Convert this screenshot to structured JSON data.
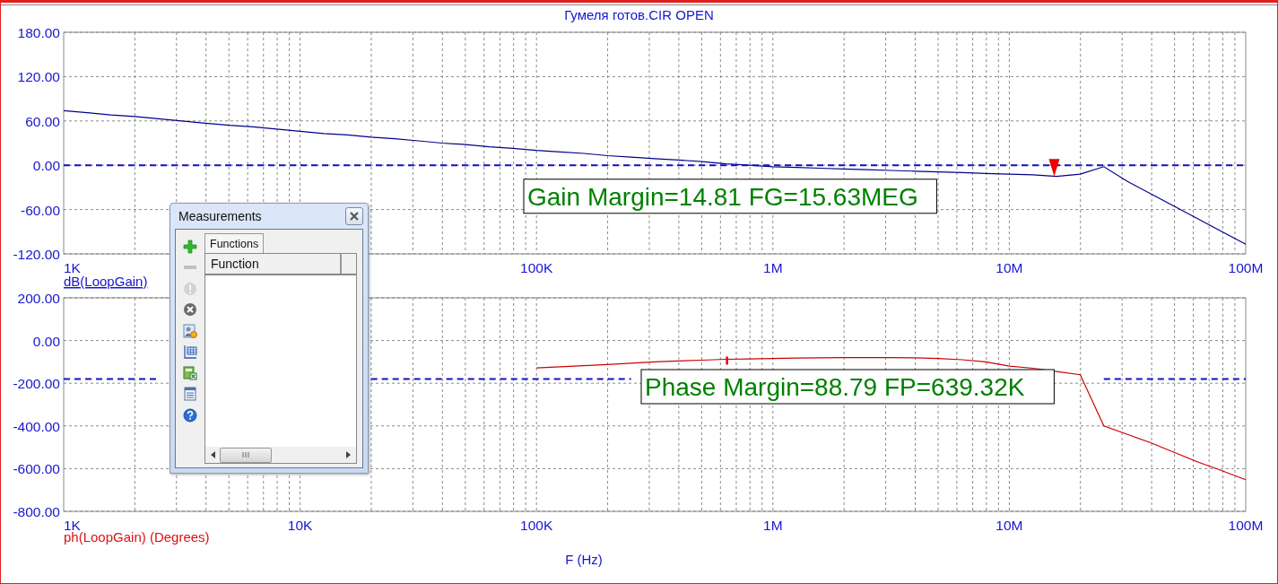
{
  "title": "Гумеля готов.CIR OPEN",
  "charts": [
    {
      "cursor": {
        "level": 0.838
      },
      "chart_data": {
        "type": "line",
        "grid": true,
        "categories": [
          "1K",
          null,
          null,
          null,
          null,
          null,
          null,
          null,
          null,
          null,
          null,
          null,
          null,
          null,
          null,
          null,
          null,
          null,
          null,
          null,
          "100K",
          null,
          null,
          null,
          null,
          null,
          null,
          null,
          null,
          null,
          "1M",
          null,
          null,
          null,
          null,
          null,
          null,
          null,
          null,
          null,
          "10M",
          null,
          null,
          null,
          null,
          null,
          null,
          null,
          null,
          null,
          "100M"
        ],
        "series": [
          {
            "name": "dB(LoopGain)",
            "color": "#00008b",
            "values": [
              74,
              71,
              68,
              66,
              63,
              60,
              57,
              54,
              52,
              49,
              46,
              43,
              41,
              38,
              36,
              33,
              30,
              28,
              25,
              23,
              20,
              18,
              16,
              13,
              11,
              9,
              7,
              5,
              2,
              0,
              -2,
              -3,
              -4,
              -5,
              -6,
              -7,
              -8,
              -9,
              -10,
              -11,
              -12,
              -13,
              -15,
              -12,
              -2,
              -22,
              -39,
              -56,
              -73,
              -90,
              -107
            ]
          },
          {
            "color": "#1010cc",
            "line_style": "dashed",
            "values": [
              0,
              0,
              0,
              0,
              0,
              0,
              0,
              0,
              0,
              0,
              0,
              0,
              0,
              0,
              0,
              0,
              0,
              0,
              0,
              0,
              0,
              0,
              0,
              0,
              0,
              0,
              0,
              0,
              0,
              0,
              0,
              0,
              0,
              0,
              0,
              0,
              0,
              0,
              0,
              0,
              0,
              0,
              0,
              0,
              0,
              0,
              0,
              0,
              0,
              0,
              0
            ]
          }
        ],
        "ylim": [
          -120,
          180
        ],
        "yticks": [
          {
            "value": 180,
            "label": "180.00"
          },
          {
            "value": 120,
            "label": "120.00"
          },
          {
            "value": 60,
            "label": "60.00"
          },
          {
            "value": 0,
            "label": "0.00"
          },
          {
            "value": -60,
            "label": "-60.00"
          },
          {
            "value": -120,
            "label": "-120.00"
          }
        ],
        "annotations": [
          "Gain Margin=14.81 FG=15.63MEG"
        ]
      }
    },
    {
      "cursor": {
        "level": 0.561
      },
      "chart_data": {
        "type": "line",
        "grid": true,
        "xlabel": "F (Hz)",
        "categories": [
          "1K",
          null,
          null,
          null,
          null,
          null,
          null,
          null,
          null,
          null,
          "10K",
          null,
          null,
          null,
          null,
          null,
          null,
          null,
          null,
          null,
          "100K",
          null,
          null,
          null,
          null,
          null,
          null,
          null,
          null,
          null,
          "1M",
          null,
          null,
          null,
          null,
          null,
          null,
          null,
          null,
          null,
          "10M",
          null,
          null,
          null,
          null,
          null,
          null,
          null,
          null,
          null,
          "100M"
        ],
        "series": [
          {
            "name": "ph(LoopGain) (Degrees)",
            "color": "#cc0000",
            "values": [
              null,
              null,
              null,
              null,
              null,
              null,
              null,
              null,
              null,
              null,
              null,
              null,
              null,
              null,
              null,
              null,
              null,
              null,
              null,
              null,
              -128,
              -123,
              -118,
              -112,
              -106,
              -100,
              -96,
              -92,
              -88,
              -86,
              -84,
              -82,
              -81,
              -80,
              -80,
              -80,
              -81,
              -84,
              -90,
              -100,
              -120,
              -130,
              -145,
              -160,
              -400,
              -440,
              -480,
              -525,
              -570,
              -610,
              -652
            ]
          },
          {
            "color": "#1010cc",
            "line_style": "dashed",
            "values": [
              -180,
              -180,
              -180,
              -180,
              -180,
              null,
              null,
              null,
              null,
              null,
              null,
              null,
              null,
              -180,
              -180,
              -180,
              -180,
              -180,
              -180,
              -180,
              -180,
              -180,
              -180,
              -180,
              -180,
              null,
              null,
              null,
              null,
              null,
              null,
              null,
              null,
              null,
              null,
              null,
              null,
              null,
              null,
              null,
              null,
              null,
              null,
              null,
              -180,
              -180,
              -180,
              -180,
              -180,
              -180,
              -180
            ]
          }
        ],
        "ylim": [
          -800,
          200
        ],
        "yticks": [
          {
            "value": 200,
            "label": "200.00"
          },
          {
            "value": 0,
            "label": "0.00"
          },
          {
            "value": -200,
            "label": "-200.00"
          },
          {
            "value": -400,
            "label": "-400.00"
          },
          {
            "value": -600,
            "label": "-600.00"
          },
          {
            "value": -800,
            "label": "-800.00"
          }
        ],
        "annotations": [
          "Phase Margin=88.79 FP=639.32K"
        ]
      }
    }
  ],
  "measurements": {
    "title": "Measurements",
    "tools": [
      {
        "kind": "add",
        "disabled": false
      },
      {
        "kind": "remove",
        "disabled": true
      },
      {
        "kind": "alert",
        "disabled": true
      },
      {
        "kind": "delete",
        "disabled": false
      },
      {
        "kind": "user-settings",
        "disabled": false
      },
      {
        "kind": "table",
        "disabled": false
      },
      {
        "kind": "spreadsheet",
        "disabled": false
      },
      {
        "kind": "document",
        "disabled": false
      },
      {
        "kind": "help",
        "disabled": false
      }
    ],
    "tabs": [
      {
        "label": "Functions",
        "selected": true
      }
    ],
    "columns": [
      "Function"
    ]
  }
}
